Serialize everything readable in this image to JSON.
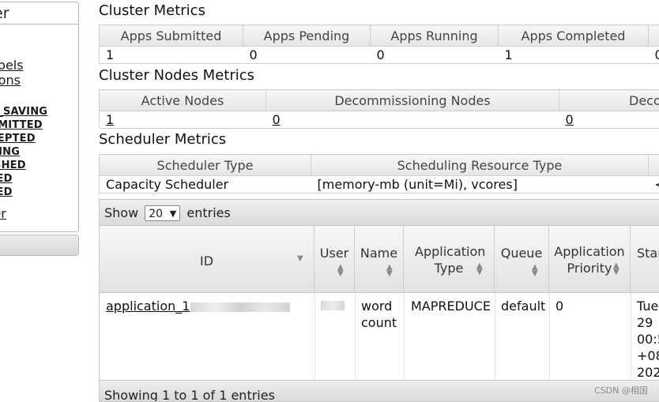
{
  "sidebar": {
    "title": "er",
    "links": [
      {
        "label": "abels",
        "size": "big"
      },
      {
        "label": "tions",
        "size": "big"
      },
      {
        "label": "V",
        "size": "small"
      },
      {
        "label": "V_SAVING",
        "size": "small"
      },
      {
        "label": "BMITTED",
        "size": "small"
      },
      {
        "label": "CEPTED",
        "size": "small"
      },
      {
        "label": "NING",
        "size": "small"
      },
      {
        "label": "ISHED",
        "size": "small"
      },
      {
        "label": "LED",
        "size": "small"
      },
      {
        "label": "LED",
        "size": "small"
      },
      {
        "label": "ler",
        "size": "big"
      }
    ]
  },
  "cluster_metrics": {
    "title": "Cluster Metrics",
    "headers": [
      "Apps Submitted",
      "Apps Pending",
      "Apps Running",
      "Apps Completed",
      ""
    ],
    "values": [
      "1",
      "0",
      "0",
      "1",
      "0"
    ]
  },
  "cluster_nodes_metrics": {
    "title": "Cluster Nodes Metrics",
    "headers": [
      "Active Nodes",
      "Decommissioning Nodes",
      "Deco"
    ],
    "values": [
      "1",
      "0",
      "0"
    ]
  },
  "scheduler_metrics": {
    "title": "Scheduler Metrics",
    "headers": [
      "Scheduler Type",
      "Scheduling Resource Type",
      ""
    ],
    "values": [
      "Capacity Scheduler",
      "[memory-mb (unit=Mi), vcores]",
      "<"
    ]
  },
  "apps_table": {
    "show_label": "Show",
    "entries_value": "20",
    "entries_label": "entries",
    "columns": [
      "ID",
      "User",
      "Name",
      "Application Type",
      "Queue",
      "Application Priority",
      "Star"
    ],
    "row": {
      "id": "application_1",
      "id_tail": "0001",
      "user": "",
      "name": "word count",
      "type": "MAPREDUCE",
      "queue": "default",
      "priority": "0",
      "start_lines": [
        "Tue",
        "29",
        "00:5",
        "+08",
        "202"
      ]
    },
    "footer": "Showing 1 to 1 of 1 entries"
  },
  "watermark": "CSDN @相国"
}
